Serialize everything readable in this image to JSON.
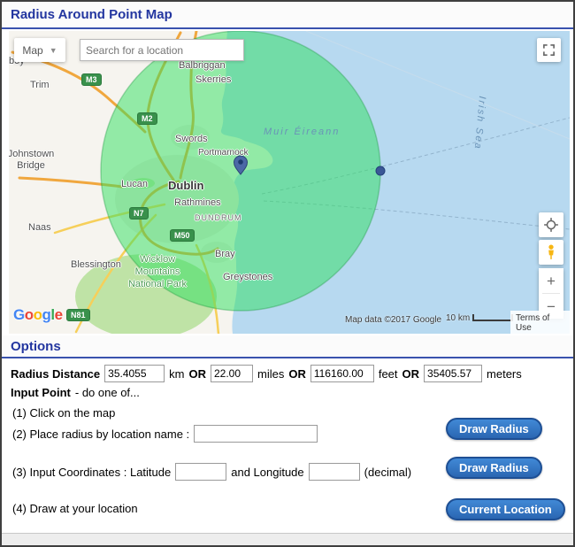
{
  "colors": {
    "accent_blue": "#2336a0",
    "button_blue": "#2a66b2",
    "radius_green": "#2ee05e",
    "water_blue": "#b7d9f0",
    "land": "#f6f4ef"
  },
  "header": {
    "title": "Radius Around Point Map"
  },
  "map": {
    "type_button_label": "Map",
    "search_placeholder": "Search for a location",
    "labels": {
      "boy": "boy",
      "trim": "Trim",
      "balbriggan": "Balbriggan",
      "skerries": "Skerries",
      "johnstown_bridge": "Johnstown Bridge",
      "swords": "Swords",
      "portmarnock": "Portmarnock",
      "muir_eireann": "Muir Éireann",
      "irish_sea": "Irish Sea",
      "lucan": "Lucan",
      "dublin": "Dublin",
      "rathmines": "Rathmines",
      "dundrum": "DUNDRUM",
      "naas": "Naas",
      "bray": "Bray",
      "blessington": "Blessington",
      "greystones": "Greystones",
      "wicklow_park": "Wicklow Mountains National Park"
    },
    "road_badges": {
      "m3": "M3",
      "m2": "M2",
      "n7": "N7",
      "m50": "M50",
      "n81": "N81"
    },
    "controls": {
      "zoom_in": "+",
      "zoom_out": "−"
    },
    "attribution": "Map data ©2017 Google",
    "scale_label": "10 km",
    "terms_label": "Terms of Use",
    "logo_letters": [
      "G",
      "o",
      "o",
      "g",
      "l",
      "e"
    ]
  },
  "options": {
    "title": "Options",
    "radius": {
      "label": "Radius Distance",
      "km_value": "35.4055",
      "km_unit": "km",
      "or": "OR",
      "miles_value": "22.00",
      "miles_unit": "miles",
      "feet_value": "116160.00",
      "feet_unit": "feet",
      "meters_value": "35405.57",
      "meters_unit": "meters"
    },
    "input_point_bold": "Input Point",
    "input_point_rest": "- do one of...",
    "step1": "(1) Click on the map",
    "step2": "(2) Place radius by location name :",
    "step3_prefix": "(3) Input Coordinates : Latitude",
    "step3_mid": "and Longitude",
    "step3_suffix": "(decimal)",
    "step4": "(4) Draw at your location",
    "buttons": {
      "draw_radius_1": "Draw Radius",
      "draw_radius_2": "Draw Radius",
      "current_location": "Current Location"
    }
  }
}
